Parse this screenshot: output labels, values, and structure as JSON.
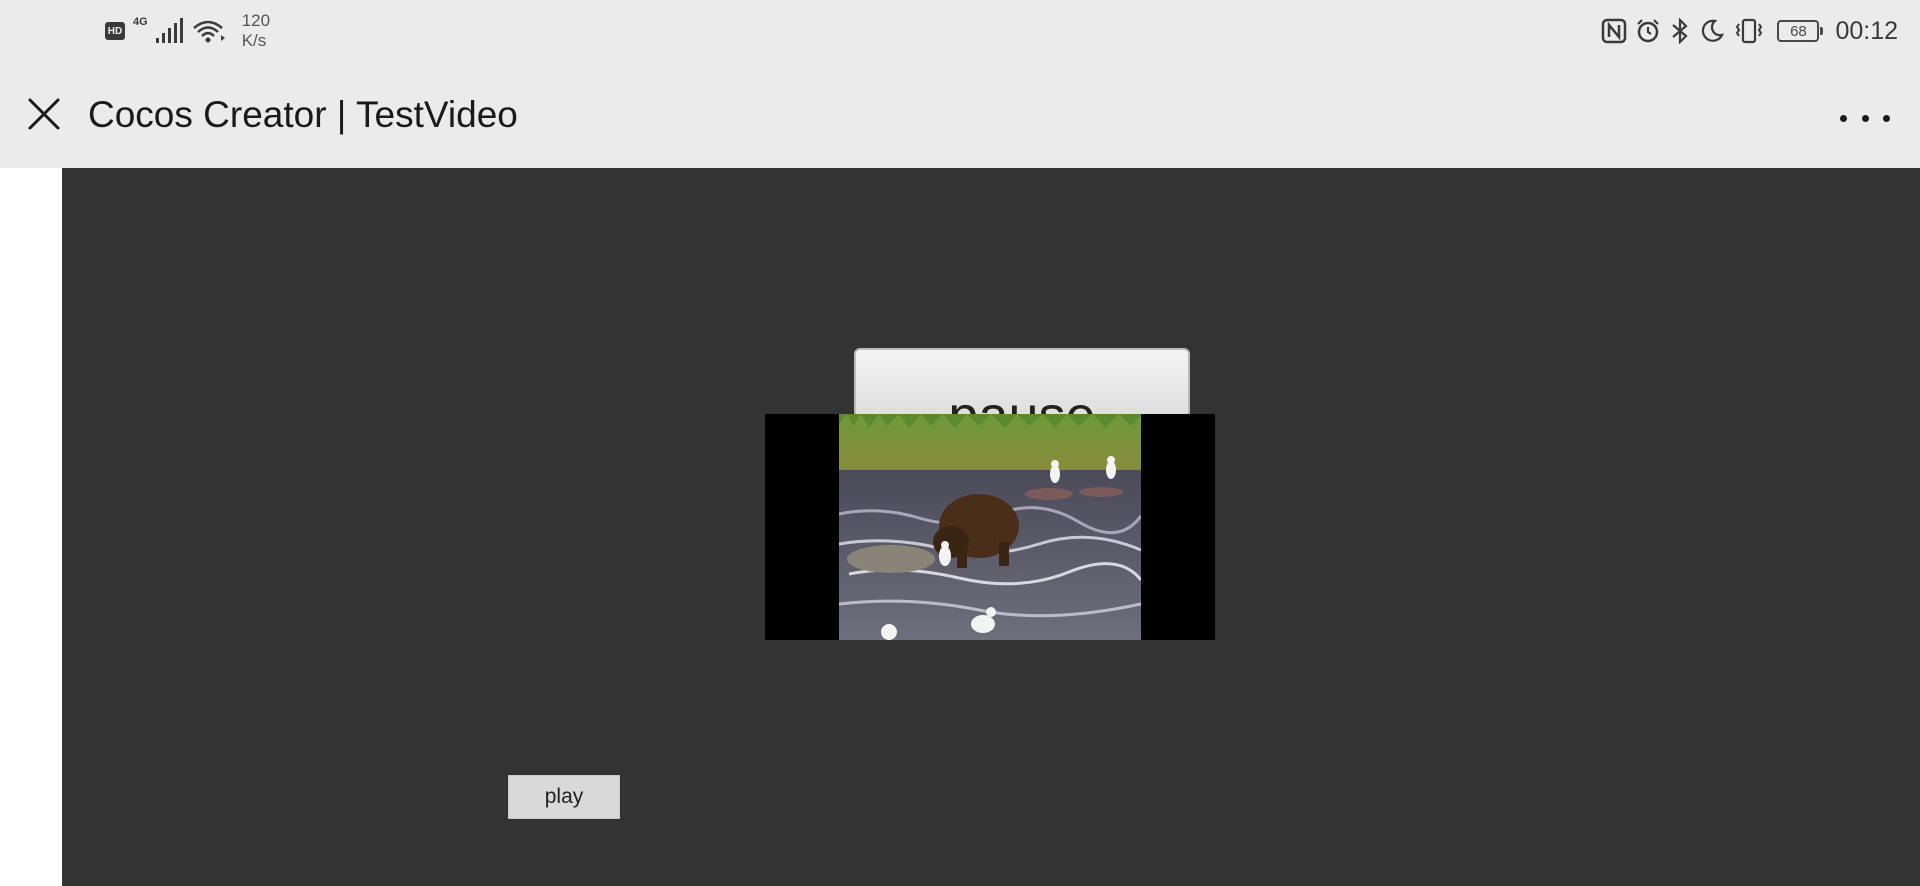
{
  "status_bar": {
    "hd": "HD",
    "network_type": "4G",
    "speed_value": "120",
    "speed_unit": "K/s",
    "battery_level": "68",
    "time": "00:12",
    "icons": [
      "hd-icon",
      "signal-icon",
      "wifi-icon",
      "nfc-icon",
      "alarm-icon",
      "bluetooth-icon",
      "moon-icon",
      "vibrate-icon",
      "battery-icon"
    ]
  },
  "title_bar": {
    "title": "Cocos Creator | TestVideo",
    "close_icon": "close-icon",
    "more_icon": "more-icon"
  },
  "scene": {
    "pause_label": "pause",
    "play_label": "play",
    "video": {
      "description_icon": "video-frame"
    }
  },
  "colors": {
    "chrome_bg": "#ebebeb",
    "canvas_bg": "#333333",
    "button_bg": "#d9d9d9",
    "video_bg": "#000000"
  }
}
